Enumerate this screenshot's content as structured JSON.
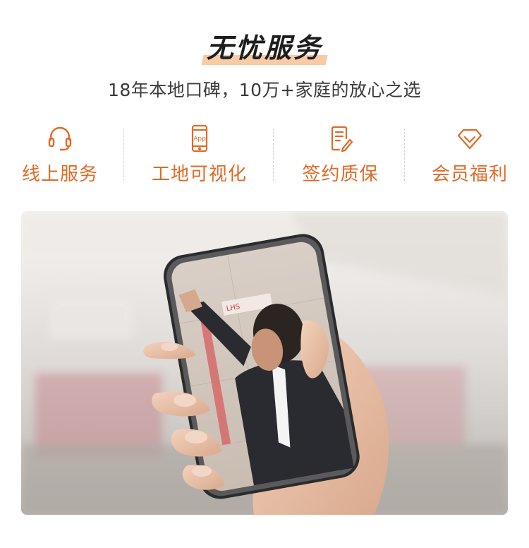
{
  "header": {
    "title": "无忧服务",
    "subtitle": "18年本地口碑，10万+家庭的放心之选"
  },
  "features": [
    {
      "icon": "headset-icon",
      "label": "线上服务"
    },
    {
      "icon": "phone-app-icon",
      "icon_text": "App",
      "label": "工地可视化"
    },
    {
      "icon": "contract-pen-icon",
      "label": "签约质保"
    },
    {
      "icon": "diamond-icon",
      "label": "会员福利"
    }
  ],
  "colors": {
    "accent": "#e06b27",
    "title_highlight": "#f6cba6",
    "text_dark": "#1d1d1d"
  }
}
